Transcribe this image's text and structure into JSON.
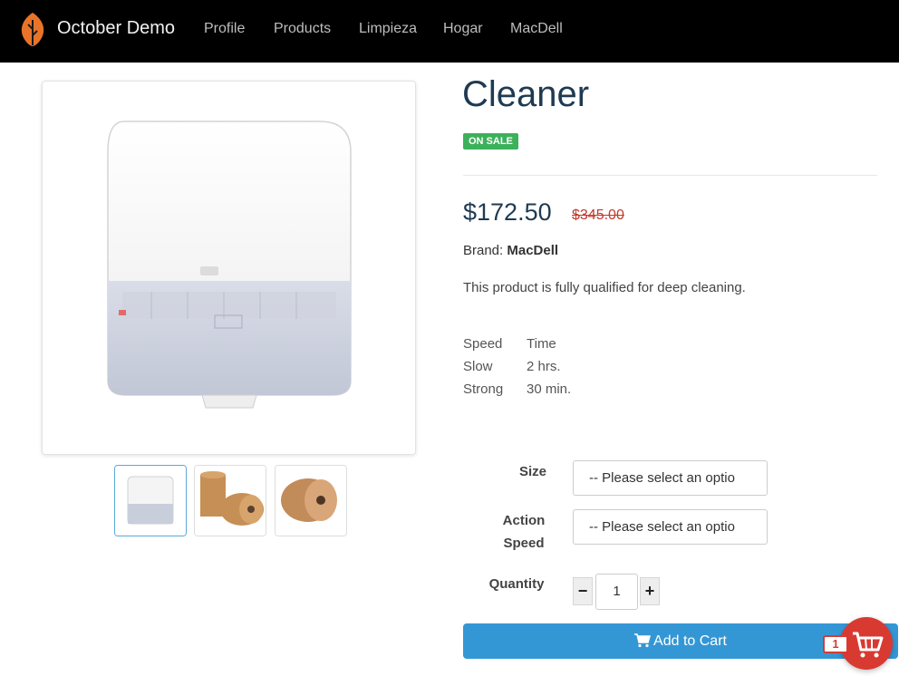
{
  "navbar": {
    "brand": "October Demo",
    "links": [
      "Profile",
      "Products",
      "Limpieza",
      "Hogar",
      "MacDell"
    ]
  },
  "product": {
    "title": "Cleaner",
    "badge": "ON SALE",
    "price": "$172.50",
    "old_price": "$345.00",
    "brand_label": "Brand:",
    "brand_name": "MacDell",
    "description": "This product is fully qualified for deep cleaning."
  },
  "specs": {
    "headers": [
      "Speed",
      "Time"
    ],
    "rows": [
      [
        "Slow",
        "2 hrs."
      ],
      [
        "Strong",
        "30 min."
      ]
    ]
  },
  "options": {
    "size_label": "Size",
    "size_value": "-- Please select an optio",
    "action_speed_label_line1": "Action",
    "action_speed_label_line2": "Speed",
    "action_speed_value": "-- Please select an optio",
    "quantity_label": "Quantity",
    "quantity_minus": "−",
    "quantity_value": "1",
    "quantity_plus": "+"
  },
  "cart": {
    "add_label": "Add to Cart",
    "count": "1"
  },
  "colors": {
    "navbar": "#000000",
    "logo_orange": "#e8742a",
    "title_navy": "#1f3a52",
    "sale_green": "#3cb15b",
    "old_price_red": "#c0392b",
    "cart_button_blue": "#3497d5",
    "cart_fab_red": "#d83a32"
  },
  "icons": [
    "leaf-logo-icon",
    "shopping-cart-icon",
    "cart-fab-icon"
  ]
}
